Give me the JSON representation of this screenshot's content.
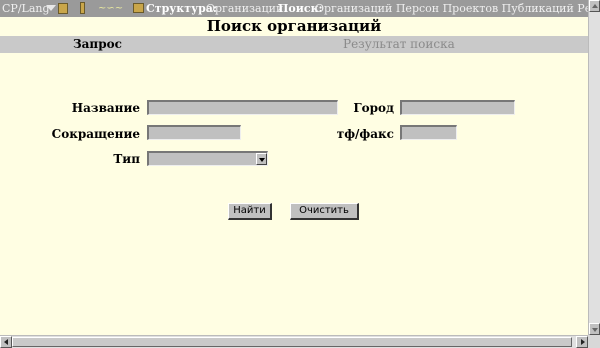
{
  "nav": {
    "lang_label": "CP/Lang",
    "signature": "",
    "structure_label": "Структура:",
    "structure_item": "Организаций",
    "search_label": "Поиск:",
    "search_items": "Организаций Персон Проектов Публикаций Рефе"
  },
  "page": {
    "title": "Поиск организаций"
  },
  "tabs": {
    "query": "Запрос",
    "result": "Результат поиска"
  },
  "form": {
    "name_label": "Название",
    "city_label": "Город",
    "abbr_label": "Сокращение",
    "phone_label": "тф/факс",
    "type_label": "Тип",
    "name_value": "",
    "city_value": "",
    "abbr_value": "",
    "phone_value": "",
    "type_selected": ""
  },
  "actions": {
    "find_label": "Найти",
    "clear_label": "Очистить"
  },
  "colors": {
    "page_bg": "#fffee3",
    "nav_bg": "#9a9a9a",
    "tabs_bg": "#c9c9c9",
    "field_bg": "#c0c0c0"
  }
}
